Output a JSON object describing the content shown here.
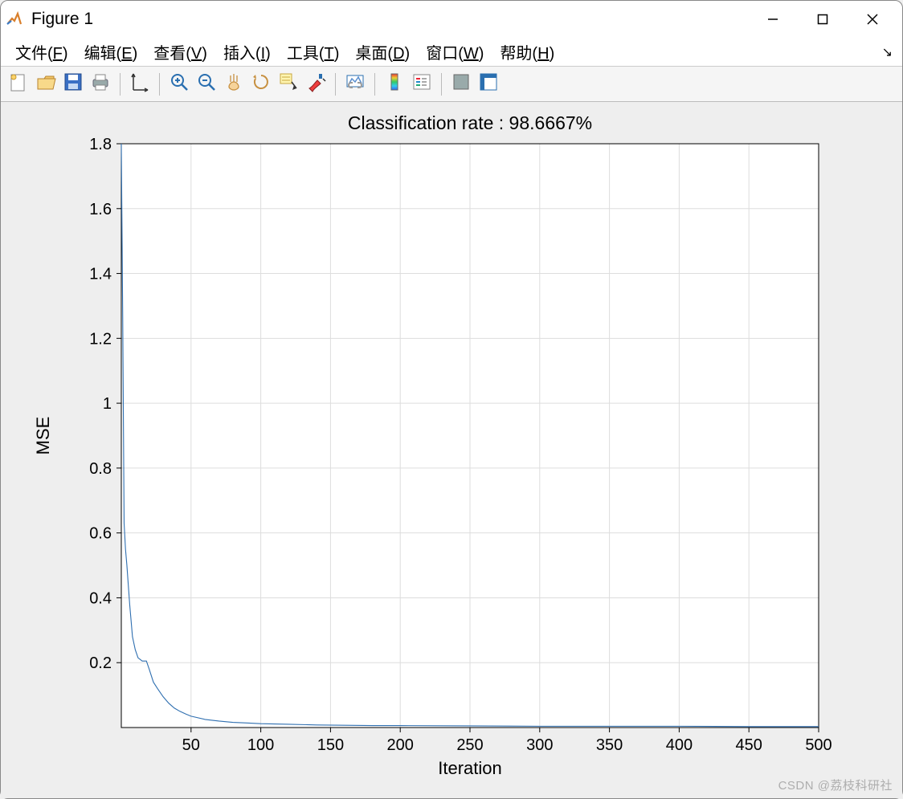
{
  "window": {
    "title": "Figure 1"
  },
  "menubar": {
    "items": [
      {
        "label": "文件(F)",
        "accel": "F"
      },
      {
        "label": "编辑(E)",
        "accel": "E"
      },
      {
        "label": "查看(V)",
        "accel": "V"
      },
      {
        "label": "插入(I)",
        "accel": "I"
      },
      {
        "label": "工具(T)",
        "accel": "T"
      },
      {
        "label": "桌面(D)",
        "accel": "D"
      },
      {
        "label": "窗口(W)",
        "accel": "W"
      },
      {
        "label": "帮助(H)",
        "accel": "H"
      }
    ]
  },
  "toolbar": {
    "groups": [
      [
        "new-figure",
        "open",
        "save",
        "print"
      ],
      [
        "edit-plot"
      ],
      [
        "zoom-in",
        "zoom-out",
        "pan",
        "rotate",
        "data-cursor",
        "brush"
      ],
      [
        "link-plot"
      ],
      [
        "colorbar",
        "legend"
      ],
      [
        "hide-plot",
        "layout"
      ]
    ]
  },
  "watermark": "CSDN @荔枝科研社",
  "chart_data": {
    "type": "line",
    "title": "Classification rate : 98.6667%",
    "xlabel": "Iteration",
    "ylabel": "MSE",
    "xlim": [
      0,
      500
    ],
    "ylim": [
      0,
      1.8
    ],
    "xticks": [
      50,
      100,
      150,
      200,
      250,
      300,
      350,
      400,
      450,
      500
    ],
    "yticks": [
      0.2,
      0.4,
      0.6,
      0.8,
      1,
      1.2,
      1.4,
      1.6,
      1.8
    ],
    "grid": true,
    "line_color": "#2f6fb0",
    "series": [
      {
        "name": "MSE",
        "x": [
          0,
          1,
          2,
          3,
          4,
          5,
          6,
          7,
          8,
          10,
          12,
          15,
          18,
          20,
          23,
          26,
          30,
          34,
          38,
          42,
          46,
          50,
          60,
          70,
          80,
          90,
          100,
          120,
          140,
          160,
          180,
          200,
          250,
          300,
          350,
          400,
          450,
          500
        ],
        "y": [
          1.8,
          1.27,
          0.63,
          0.55,
          0.5,
          0.44,
          0.38,
          0.33,
          0.28,
          0.24,
          0.215,
          0.205,
          0.205,
          0.18,
          0.14,
          0.12,
          0.095,
          0.075,
          0.06,
          0.05,
          0.042,
          0.035,
          0.025,
          0.02,
          0.016,
          0.014,
          0.012,
          0.01,
          0.008,
          0.007,
          0.006,
          0.006,
          0.005,
          0.004,
          0.004,
          0.004,
          0.003,
          0.003
        ]
      }
    ]
  }
}
